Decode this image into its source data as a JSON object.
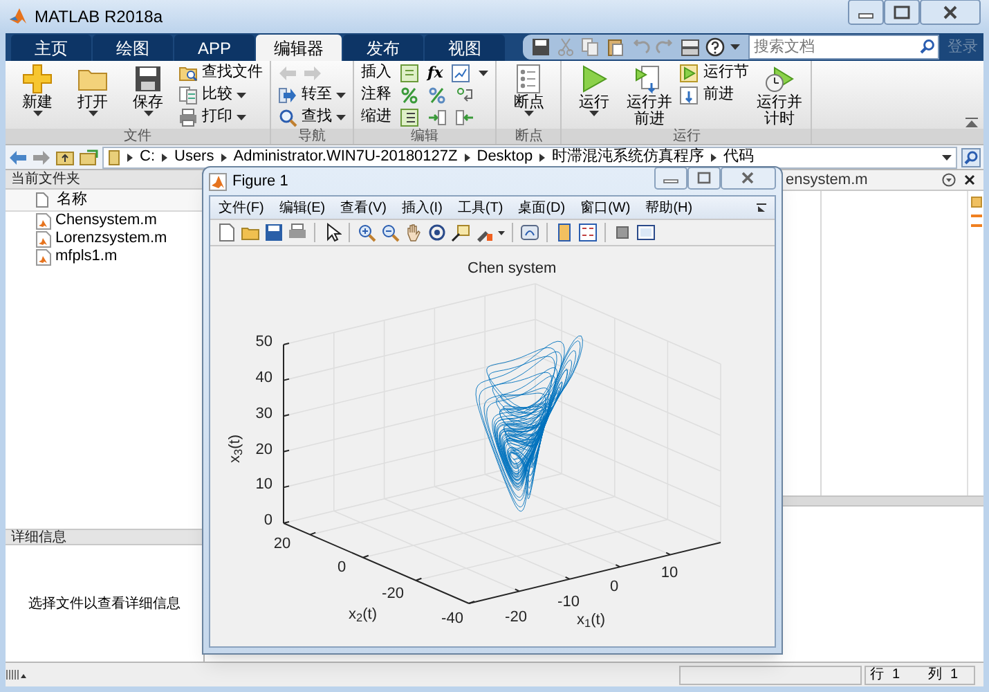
{
  "window": {
    "title": "MATLAB R2018a"
  },
  "tabs": [
    {
      "label": "主页",
      "selected": false
    },
    {
      "label": "绘图",
      "selected": false
    },
    {
      "label": "APP",
      "selected": false
    },
    {
      "label": "编辑器",
      "selected": true
    },
    {
      "label": "发布",
      "selected": false
    },
    {
      "label": "视图",
      "selected": false
    }
  ],
  "search": {
    "placeholder": "搜索文档"
  },
  "login": {
    "label": "登录",
    "disabled": true
  },
  "ribbon_groups": [
    {
      "label": "文件",
      "items": [
        {
          "kind": "large",
          "label": "新建",
          "dropdown": true
        },
        {
          "kind": "large",
          "label": "打开",
          "dropdown": true
        },
        {
          "kind": "large",
          "label": "保存",
          "dropdown": true
        },
        {
          "kind": "stack",
          "entries": [
            {
              "label": "查找文件",
              "dropdown": false
            },
            {
              "label": "比较",
              "dropdown": true
            },
            {
              "label": "打印",
              "dropdown": true
            }
          ]
        }
      ]
    },
    {
      "label": "导航",
      "items": [
        {
          "kind": "nav",
          "history_disabled": true,
          "entries": [
            {
              "label": "转至",
              "dropdown": true
            },
            {
              "label": "查找",
              "dropdown": true
            }
          ]
        }
      ]
    },
    {
      "label": "编辑",
      "items": [
        {
          "kind": "rows",
          "entries": [
            {
              "label": "插入",
              "symbol": "fx",
              "dropdown": true
            },
            {
              "label": "注释",
              "dropdown": false
            },
            {
              "label": "缩进",
              "dropdown": false
            }
          ]
        }
      ]
    },
    {
      "label": "断点",
      "items": [
        {
          "kind": "large",
          "label": "断点",
          "dropdown": true
        }
      ]
    },
    {
      "label": "运行",
      "items": [
        {
          "kind": "large",
          "label": "运行",
          "dropdown": true
        },
        {
          "kind": "large",
          "label": "运行并前进",
          "dropdown": false
        },
        {
          "kind": "stack",
          "entries": [
            {
              "label": "运行节",
              "dropdown": false
            },
            {
              "label": "前进",
              "dropdown": false
            }
          ]
        },
        {
          "kind": "large",
          "label": "运行并计时",
          "dropdown": false
        }
      ]
    }
  ],
  "address_bar": {
    "path": [
      "C:",
      "Users",
      "Administrator.WIN7U-20180127Z",
      "Desktop",
      "时滞混沌系统仿真程序",
      "代码"
    ]
  },
  "current_folder": {
    "title": "当前文件夹",
    "column": "名称",
    "files": [
      "Chensystem.m",
      "Lorenzsystem.m",
      "mfpls1.m"
    ]
  },
  "details": {
    "title": "详细信息",
    "message": "选择文件以查看详细信息"
  },
  "editor": {
    "tab": "ensystem.m"
  },
  "figure": {
    "title": "Figure 1",
    "menu": [
      "文件(F)",
      "编辑(E)",
      "查看(V)",
      "插入(I)",
      "工具(T)",
      "桌面(D)",
      "窗口(W)",
      "帮助(H)"
    ],
    "plot": {
      "title": "Chen system",
      "xlabel": "x$_{1}$(t)",
      "ylabel": "x$_{2}$(t)",
      "zlabel": "x$_{3}$(t)",
      "xticks": [
        "-20",
        "-10",
        "0",
        "10"
      ],
      "yticks": [
        "20",
        "0",
        "-20",
        "-40"
      ],
      "zticks": [
        "50",
        "40",
        "30",
        "20",
        "10",
        "0"
      ]
    }
  },
  "status_bar": {
    "row_label": "行",
    "row": "1",
    "col_label": "列",
    "col": "1"
  }
}
